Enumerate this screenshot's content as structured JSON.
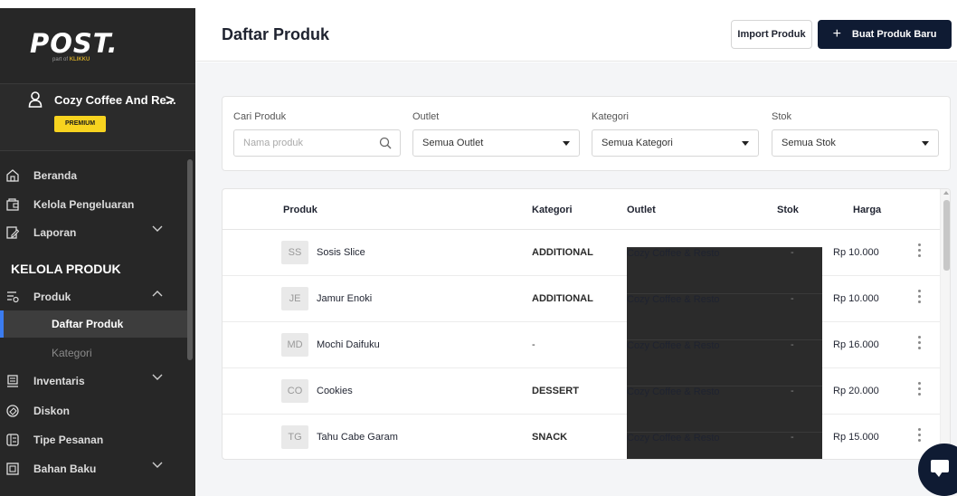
{
  "sidebar": {
    "logo": "POST.",
    "logo_sub_prefix": "part of",
    "logo_sub_brand": "KLIKKU",
    "outlet_name": "Cozy Coffee And Re...",
    "outlet_arrow": ">",
    "badge": "PREMIUM",
    "items_top": [
      {
        "label": "Beranda",
        "icon": "home-icon"
      },
      {
        "label": "Kelola Pengeluaran",
        "icon": "wallet-icon"
      },
      {
        "label": "Laporan",
        "icon": "report-edit-icon",
        "has_chevron": true
      }
    ],
    "section_title": "KELOLA PRODUK",
    "produk": {
      "label": "Produk",
      "icon": "product-settings-icon"
    },
    "sub_items": [
      {
        "label": "Daftar Produk",
        "active": true
      },
      {
        "label": "Kategori",
        "active": false
      }
    ],
    "items_bottom": [
      {
        "label": "Inventaris",
        "icon": "warehouse-icon",
        "has_chevron": true
      },
      {
        "label": "Diskon",
        "icon": "discount-tag-icon"
      },
      {
        "label": "Tipe Pesanan",
        "icon": "order-list-icon"
      },
      {
        "label": "Bahan Baku",
        "icon": "ingredient-box-icon",
        "has_chevron": true
      }
    ]
  },
  "header": {
    "title": "Daftar Produk",
    "import_label": "Import Produk",
    "new_label": "Buat Produk Baru",
    "new_icon": "+"
  },
  "filters": {
    "search_label": "Cari Produk",
    "search_placeholder": "Nama produk",
    "outlet_label": "Outlet",
    "outlet_value": "Semua Outlet",
    "kategori_label": "Kategori",
    "kategori_value": "Semua Kategori",
    "stok_label": "Stok",
    "stok_value": "Semua Stok"
  },
  "table": {
    "columns": [
      "Produk",
      "Kategori",
      "Outlet",
      "Stok",
      "Harga"
    ],
    "rows": [
      {
        "initials": "SS",
        "name": "Sosis Slice",
        "kategori": "ADDITIONAL",
        "outlet": "Cozy Coffee & Resto",
        "stok": "-",
        "harga": "Rp 10.000"
      },
      {
        "initials": "JE",
        "name": "Jamur Enoki",
        "kategori": "ADDITIONAL",
        "outlet": "Cozy Coffee & Resto",
        "stok": "-",
        "harga": "Rp 10.000"
      },
      {
        "initials": "MD",
        "name": "Mochi Daifuku",
        "kategori": "-",
        "outlet": "Cozy Coffee & Resto",
        "stok": "-",
        "harga": "Rp 16.000"
      },
      {
        "initials": "CO",
        "name": "Cookies",
        "kategori": "DESSERT",
        "outlet": "Cozy Coffee & Resto",
        "stok": "-",
        "harga": "Rp 20.000"
      },
      {
        "initials": "TG",
        "name": "Tahu Cabe Garam",
        "kategori": "SNACK",
        "outlet": "Cozy Coffee & Resto",
        "stok": "-",
        "harga": "Rp 15.000"
      }
    ]
  },
  "colors": {
    "sidebar_bg": "#272727",
    "primary": "#0f1b33",
    "premium": "#f7d31f",
    "active_accent": "#3b7cf0"
  }
}
